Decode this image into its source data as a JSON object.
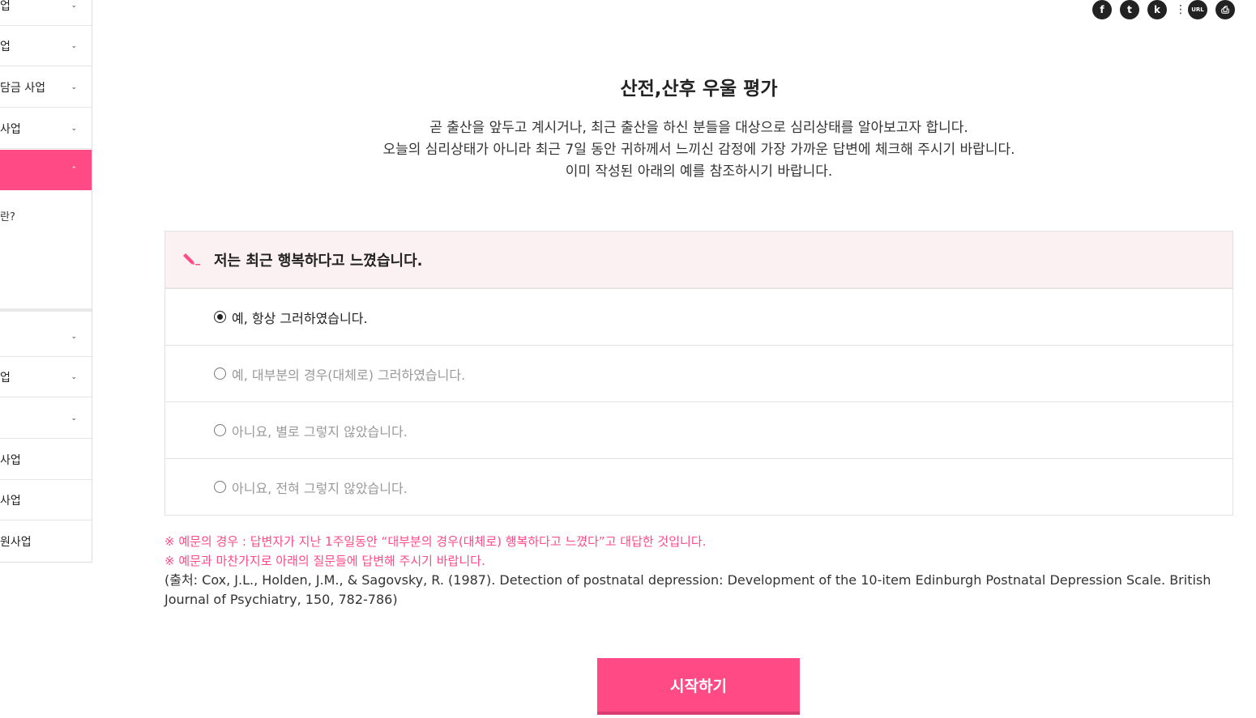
{
  "sidebar": {
    "items": [
      {
        "label": "업",
        "chevron": "⌄"
      },
      {
        "label": "업",
        "chevron": "⌄"
      },
      {
        "label": "담금 사업",
        "chevron": "⌄"
      },
      {
        "label": "사업",
        "chevron": "⌄"
      },
      {
        "label": "",
        "chevron": "⌃"
      },
      {
        "label": "",
        "chevron": "⌄"
      },
      {
        "label": "업",
        "chevron": "⌄"
      },
      {
        "label": "",
        "chevron": "⌄"
      },
      {
        "label": "사업",
        "chevron": ""
      },
      {
        "label": "사업",
        "chevron": ""
      },
      {
        "label": "원사업",
        "chevron": ""
      }
    ],
    "sub_item": "란?"
  },
  "share": {
    "facebook": "f",
    "twitter": "t",
    "kakao": "k",
    "more": "⋮",
    "url": "URL",
    "print": "⎙"
  },
  "page": {
    "title": "산전,산후 우울 평가",
    "intro": [
      "곧 출산을 앞두고 계시거나, 최근 출산을 하신 분들을 대상으로 심리상태를 알아보고자 합니다.",
      "오늘의 심리상태가 아니라 최근 7일 동안 귀하께서 느끼신 감정에 가장 가까운 답변에 체크해 주시기 바랍니다.",
      "이미 작성된 아래의 예를 참조하시기 바랍니다."
    ]
  },
  "example": {
    "question": "저는 최근 행복하다고 느꼈습니다.",
    "options": [
      {
        "label": "예, 항상 그러하였습니다.",
        "checked": true
      },
      {
        "label": "예, 대부분의 경우(대체로) 그러하였습니다.",
        "checked": false
      },
      {
        "label": "아니요, 별로 그렇지 않았습니다.",
        "checked": false
      },
      {
        "label": "아니요, 전혀 그렇지 않았습니다.",
        "checked": false
      }
    ]
  },
  "notes": {
    "line1": "※  예문의 경우 : 답변자가 지난 1주일동안 “대부분의 경우(대체로) 행복하다고 느꼈다”고 대답한 것입니다.",
    "line2": "※  예문과 마찬가지로 아래의 질문들에 답변해 주시기 바랍니다.",
    "source": "(출처: Cox, J.L., Holden, J.M., & Sagovsky, R. (1987). Detection of postnatal depression: Development of the 10-item Edinburgh Postnatal Depression Scale. British Journal of Psychiatry, 150, 782-786)"
  },
  "start_button": "시작하기",
  "colors": {
    "accent": "#ff4a86",
    "question_bg": "#fbf1f3"
  }
}
